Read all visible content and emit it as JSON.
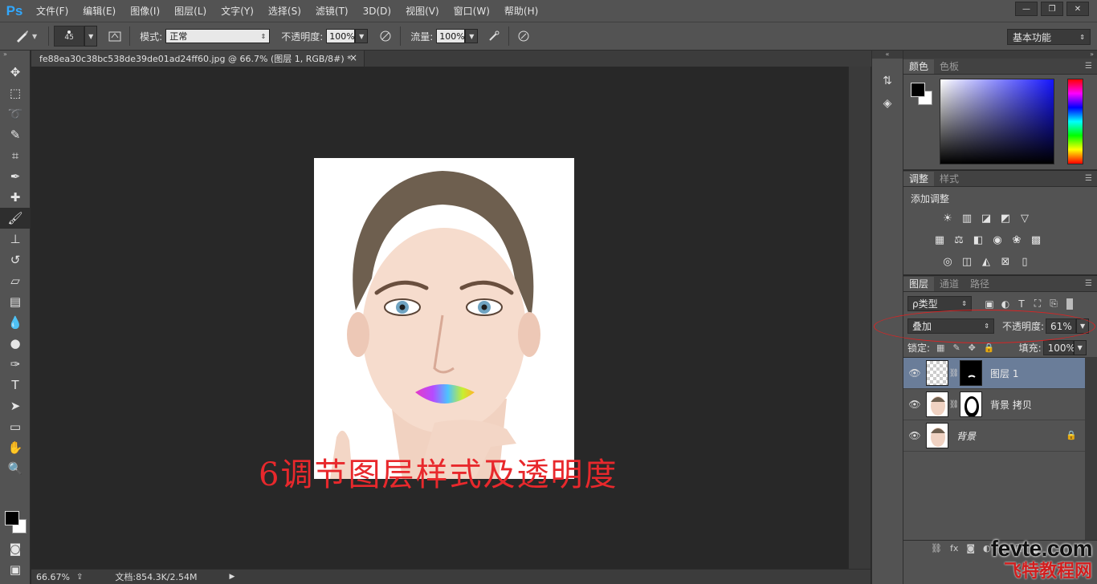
{
  "app": {
    "logo": "Ps"
  },
  "menu": [
    "文件(F)",
    "编辑(E)",
    "图像(I)",
    "图层(L)",
    "文字(Y)",
    "选择(S)",
    "滤镜(T)",
    "3D(D)",
    "视图(V)",
    "窗口(W)",
    "帮助(H)"
  ],
  "window_controls": {
    "minimize": "—",
    "restore": "❐",
    "close": "✕"
  },
  "options_bar": {
    "brush_size": "45",
    "mode_label": "模式:",
    "mode_value": "正常",
    "opacity_label": "不透明度:",
    "opacity_value": "100%",
    "flow_label": "流量:",
    "flow_value": "100%",
    "workspace": "基本功能"
  },
  "document": {
    "tab_title": "fe88ea30c38bc538de39de01ad24ff60.jpg @ 66.7% (图层 1, RGB/8#) *",
    "close": "×",
    "annotation": "6调节图层样式及透明度"
  },
  "status": {
    "zoom": "66.67%",
    "doc_info": "文档:854.3K/2.54M"
  },
  "panels": {
    "color_tabs": [
      "颜色",
      "色板"
    ],
    "adjust_tabs": [
      "调整",
      "样式"
    ],
    "adjust_title": "添加调整",
    "layers_tabs": [
      "图层",
      "通道",
      "路径"
    ],
    "filter_type": "ρ类型",
    "blend_mode": "叠加",
    "opacity_label": "不透明度:",
    "opacity_value": "61%",
    "lock_label": "锁定:",
    "fill_label": "填充:",
    "fill_value": "100%",
    "layers": [
      {
        "name": "图层 1",
        "selected": true
      },
      {
        "name": "背景 拷贝",
        "selected": false
      },
      {
        "name": "背景",
        "selected": false,
        "locked": true
      }
    ]
  },
  "watermark": {
    "line1": "fevte.com",
    "line2": "飞特教程网"
  },
  "colors": {
    "accent": "#31a8ff",
    "annotation": "#e8282c",
    "selected_layer": "#6a7d99"
  }
}
